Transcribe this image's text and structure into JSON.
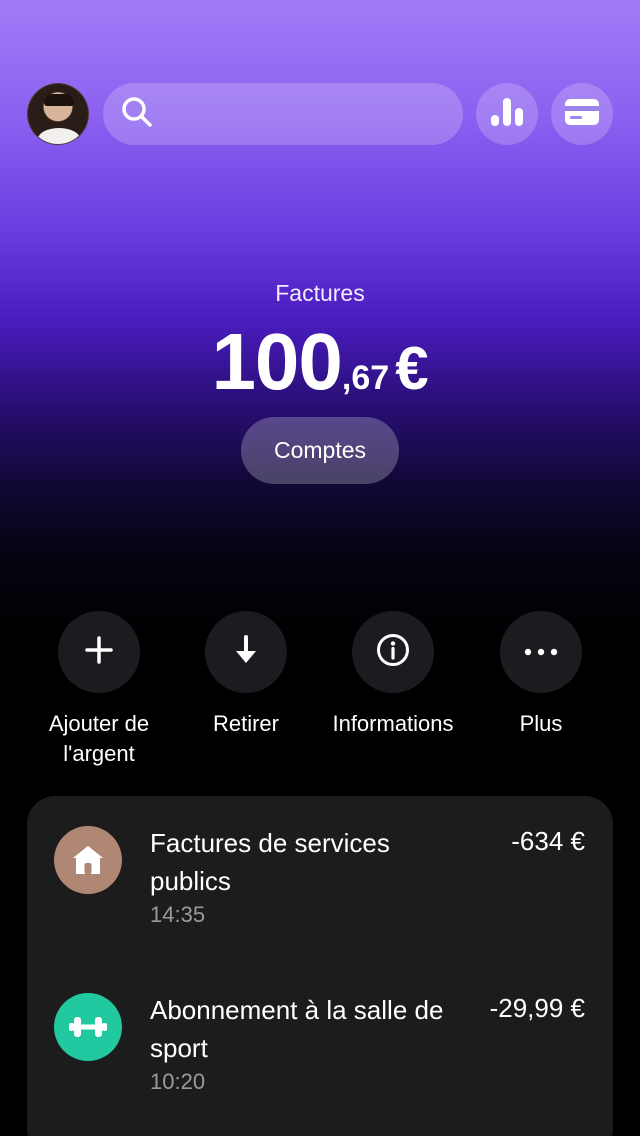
{
  "header": {
    "search_placeholder": "",
    "avatar_alt": "profile"
  },
  "balance": {
    "label": "Factures",
    "integer": "100",
    "decimal": ",67",
    "currency": "€",
    "accounts_button": "Comptes"
  },
  "actions": [
    {
      "label": "Ajouter de l'argent",
      "icon": "plus-icon"
    },
    {
      "label": "Retirer",
      "icon": "arrow-down-icon"
    },
    {
      "label": "Informations",
      "icon": "info-icon"
    },
    {
      "label": "Plus",
      "icon": "more-icon"
    }
  ],
  "transactions": [
    {
      "title": "Factures de services publics",
      "time": "14:35",
      "amount": "-634 €",
      "icon": "home-icon",
      "icon_color": "#b08774"
    },
    {
      "title": "Abonnement à la salle de sport",
      "time": "10:20",
      "amount": "-29,99 €",
      "icon": "dumbbell-icon",
      "icon_color": "#22c9a0"
    }
  ],
  "colors": {
    "gradient_top": "#a07cf6",
    "gradient_mid": "#4a1cc0",
    "background": "#000000",
    "card": "#1c1c1c"
  }
}
